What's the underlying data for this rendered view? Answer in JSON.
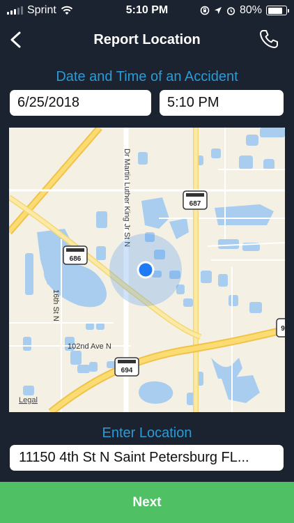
{
  "status_bar": {
    "carrier": "Sprint",
    "time": "5:10 PM",
    "battery": "80%",
    "battery_level": 0.8
  },
  "nav": {
    "title": "Report Location"
  },
  "datetime_section": {
    "label": "Date and Time of an Accident",
    "date_value": "6/25/2018",
    "time_value": "5:10 PM"
  },
  "map": {
    "road_labels": {
      "mlk": "Dr Martin Luther King Jr St N",
      "sixteenth": "16th St N",
      "hundred_second": "102nd Ave N"
    },
    "shields": {
      "s687": "687",
      "s686": "686",
      "s694": "694",
      "s9": "9"
    },
    "legal": "Legal"
  },
  "location_section": {
    "label": "Enter Location",
    "value": "11150 4th St N Saint Petersburg FL..."
  },
  "next_button": {
    "label": "Next"
  }
}
